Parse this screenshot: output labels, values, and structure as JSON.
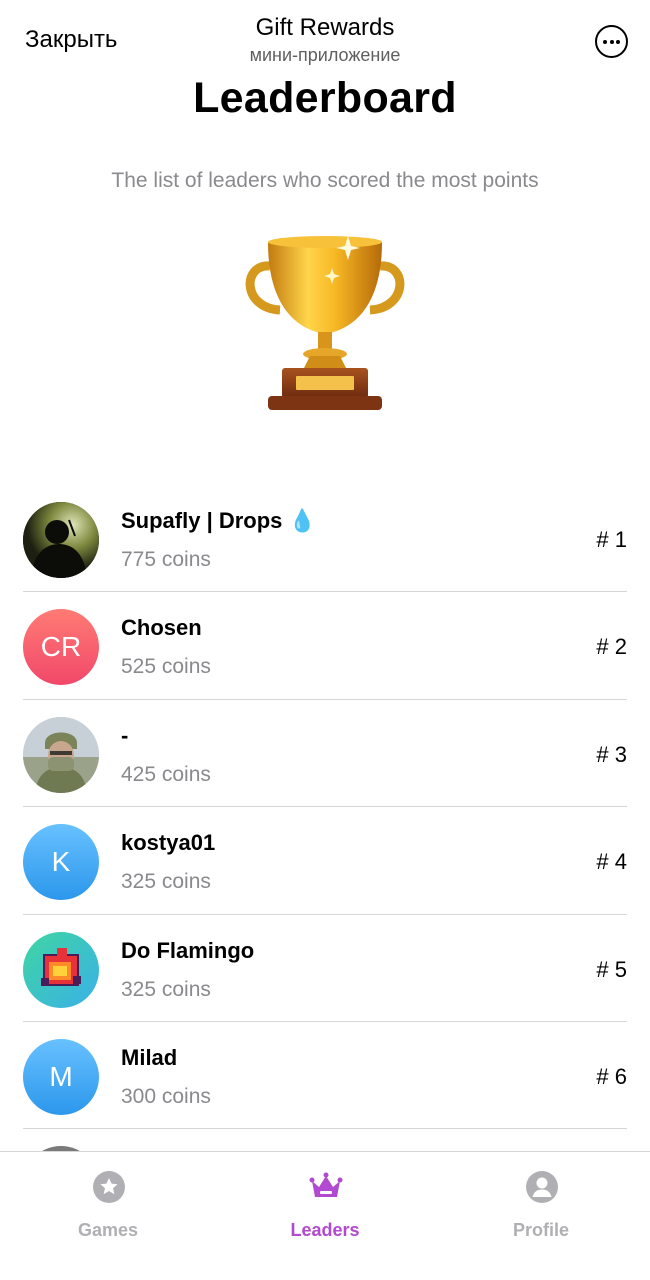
{
  "topbar": {
    "close_label": "Закрыть",
    "title": "Gift Rewards",
    "subtitle": "мини-приложение",
    "more_icon": "more-horizontal-icon"
  },
  "header": {
    "title": "Leaderboard",
    "subtitle": "The list of leaders who scored the most points",
    "icon": "trophy-icon"
  },
  "leaders": [
    {
      "name": "Supafly | Drops 💧",
      "coins": "775 coins",
      "rank": "# 1",
      "avatar_type": "photo"
    },
    {
      "name": "Chosen",
      "coins": "525 coins",
      "rank": "# 2",
      "avatar_type": "initials",
      "initials": "CR",
      "avatar_color": "#f8596b"
    },
    {
      "name": "-",
      "coins": "425 coins",
      "rank": "# 3",
      "avatar_type": "photo"
    },
    {
      "name": "kostya01",
      "coins": "325 coins",
      "rank": "# 4",
      "avatar_type": "initials",
      "initials": "K",
      "avatar_color": "#3aa3f2"
    },
    {
      "name": "Do Flamingo",
      "coins": "325 coins",
      "rank": "# 5",
      "avatar_type": "photo"
    },
    {
      "name": "Milad",
      "coins": "300 coins",
      "rank": "# 6",
      "avatar_type": "initials",
      "initials": "M",
      "avatar_color": "#3aa3f2"
    }
  ],
  "tabs": [
    {
      "label": "Games",
      "icon": "star-circle-icon",
      "active": false
    },
    {
      "label": "Leaders",
      "icon": "crown-icon",
      "active": true
    },
    {
      "label": "Profile",
      "icon": "user-circle-icon",
      "active": false
    }
  ],
  "colors": {
    "accent": "#b14ad0",
    "inactive": "#b0b0b4",
    "secondary_text": "#8a8a8e"
  }
}
